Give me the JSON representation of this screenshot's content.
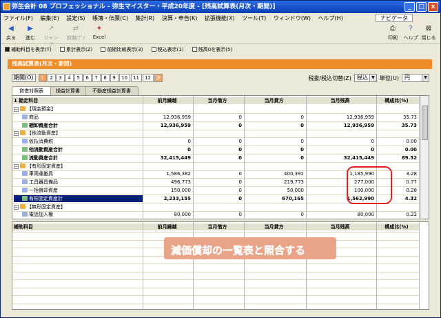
{
  "window": {
    "title": "弥生会計 08 プロフェッショナル - 弥生マイスター・平成20年度 - [残高試算表(月次・期間)]",
    "buttons": [
      "_",
      "□",
      "x"
    ]
  },
  "menu": {
    "items": [
      "ファイル(F)",
      "編集(E)",
      "設定(S)",
      "帳簿・伝票(C)",
      "集計(R)",
      "決算・申告(K)",
      "拡張機能(X)",
      "ツール(T)",
      "ウィンドウ(W)",
      "ヘルプ(H)"
    ],
    "nav": "ナビゲータ"
  },
  "toolbar": {
    "left": [
      {
        "label": "戻る",
        "icon": "◀"
      },
      {
        "label": "進む",
        "icon": "▶"
      },
      {
        "label": "ジャンプ",
        "icon": "↗"
      },
      {
        "label": "前期/ﾌﾟﾘ",
        "icon": "⇄"
      },
      {
        "label": "Excel",
        "icon": "✦"
      }
    ],
    "right": [
      {
        "label": "印刷",
        "icon": "⎙"
      },
      {
        "label": "ヘルプ",
        "icon": "?"
      },
      {
        "label": "閉じる",
        "icon": "⊠"
      }
    ]
  },
  "options": [
    "補助科目を表示(T)",
    "累計表示(Z)",
    "前期比較表示(3)",
    "税込表示(1)",
    "残高0を表示(5)"
  ],
  "section": {
    "title": "残高試算表(月次・期間)"
  },
  "period": {
    "label": "期間(O)",
    "months": [
      "1",
      "2",
      "3",
      "4",
      "5",
      "6",
      "7",
      "8",
      "9",
      "10",
      "11",
      "12",
      "決"
    ]
  },
  "tax": {
    "label": "税抜/税込切替(Z)",
    "value": "税込",
    "unit_label": "単位(U)",
    "unit": "円"
  },
  "tabs": [
    "貸借対照表",
    "損益計算書",
    "不動産損益計算書"
  ],
  "table": {
    "headers": [
      "1 勘定科目",
      "前月繰越",
      "当月借方",
      "当月貸方",
      "当月残高",
      "構成比(%)"
    ],
    "rows": [
      {
        "name": "【現金預金】",
        "cells": [
          "",
          "",
          "",
          "",
          ""
        ],
        "type": "group"
      },
      {
        "name": "商品",
        "cells": [
          "12,936,959",
          "0",
          "0",
          "12,936,959",
          "35.73"
        ],
        "type": "item"
      },
      {
        "name": "棚卸資産合計",
        "cells": [
          "12,936,959",
          "0",
          "0",
          "12,936,959",
          "35.73"
        ],
        "type": "sum"
      },
      {
        "name": "【他流動資産】",
        "cells": [
          "",
          "",
          "",
          "",
          ""
        ],
        "type": "group"
      },
      {
        "name": "仮払消費税",
        "cells": [
          "0",
          "0",
          "0",
          "0",
          "0.00"
        ],
        "type": "item"
      },
      {
        "name": "他流動資産合計",
        "cells": [
          "0",
          "0",
          "0",
          "0",
          "0.00"
        ],
        "type": "sum"
      },
      {
        "name": "流動資産合計",
        "cells": [
          "32,415,449",
          "0",
          "0",
          "32,415,449",
          "89.52"
        ],
        "type": "sum"
      },
      {
        "name": "【有形固定資産】",
        "cells": [
          "",
          "",
          "",
          "",
          ""
        ],
        "type": "group"
      },
      {
        "name": "車両運搬具",
        "cells": [
          "1,586,382",
          "0",
          "400,392",
          "1,185,990",
          "3.28"
        ],
        "type": "item"
      },
      {
        "name": "工具器具備品",
        "cells": [
          "496,773",
          "0",
          "219,773",
          "277,000",
          "0.77"
        ],
        "type": "item"
      },
      {
        "name": "一括償却資産",
        "cells": [
          "150,000",
          "0",
          "50,000",
          "100,000",
          "0.28"
        ],
        "type": "item"
      },
      {
        "name": "有形固定資産計",
        "cells": [
          "2,233,155",
          "0",
          "670,165",
          "1,562,990",
          "4.32"
        ],
        "type": "selected"
      },
      {
        "name": "【無形固定資産】",
        "cells": [
          "",
          "",
          "",
          "",
          ""
        ],
        "type": "group"
      },
      {
        "name": "電話加入権",
        "cells": [
          "80,000",
          "0",
          "0",
          "80,000",
          "0.22"
        ],
        "type": "item"
      }
    ],
    "sub_headers": [
      "補助科目",
      "前月繰越",
      "当月借方",
      "当月貸方",
      "当月残高",
      "構成比(%)"
    ]
  },
  "annotation": "減価償却の一覧表と照合する"
}
